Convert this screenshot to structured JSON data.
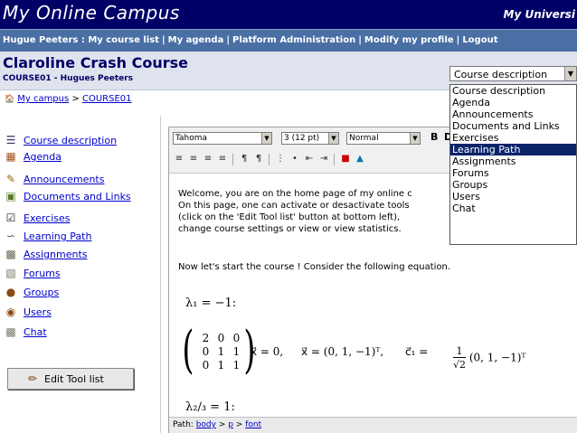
{
  "banner": {
    "title": "My Online Campus",
    "university": "My Universi"
  },
  "nav": {
    "user_label": "Hugue Peeters : My course list",
    "links": [
      "My agenda",
      "Platform Administration",
      "Modify my profile",
      "Logout"
    ]
  },
  "course": {
    "title": "Claroline Crash Course",
    "subtitle": "COURSE01 - Hugues Peeters"
  },
  "breadcrumb": {
    "home": "My campus",
    "current": "COURSE01"
  },
  "course_select": {
    "value": "Course description",
    "options": [
      "Course description",
      "Agenda",
      "Announcements",
      "Documents and Links",
      "Exercises",
      "Learning Path",
      "Assignments",
      "Forums",
      "Groups",
      "Users",
      "Chat"
    ],
    "highlighted": "Learning Path"
  },
  "tools": [
    {
      "label": "Course description",
      "icon": "list-icon"
    },
    {
      "label": "Agenda",
      "icon": "calendar-icon"
    },
    {
      "label": "Announcements",
      "icon": "announcement-icon"
    },
    {
      "label": "Documents and Links",
      "icon": "documents-icon"
    },
    {
      "label": "Exercises",
      "icon": "checkbox-icon"
    },
    {
      "label": "Learning Path",
      "icon": "path-icon"
    },
    {
      "label": "Assignments",
      "icon": "assignment-icon"
    },
    {
      "label": "Forums",
      "icon": "forum-icon"
    },
    {
      "label": "Groups",
      "icon": "groups-icon"
    },
    {
      "label": "Users",
      "icon": "user-icon"
    },
    {
      "label": "Chat",
      "icon": "chat-icon"
    }
  ],
  "edit_tools_label": "Edit Tool list",
  "editor": {
    "font": "Tahoma",
    "size": "3 (12 pt)",
    "format": "Normal",
    "bold": "B",
    "d": "D",
    "welcome_lines": [
      "Welcome, you are on the home page of my online c",
      "On this page, one can activate or desactivate tools",
      "(click on the 'Edit Tool list' button at bottom left),",
      "change course settings or view or view statistics."
    ],
    "start_text": "Now let's start the course ! Consider the following equation.",
    "math": {
      "lambda1": "λ₁ = −1:",
      "matrix_rows": [
        [
          "2",
          "0",
          "0"
        ],
        [
          "0",
          "1",
          "1"
        ],
        [
          "0",
          "1",
          "1"
        ]
      ],
      "eq1": "x⃗ = 0,",
      "eq2": "x⃗ = (0, 1, −1)ᵀ,",
      "eq3_lhs": "c⃗₁ =",
      "frac_num": "1",
      "frac_den": "√2",
      "eq3_rhs": "(0, 1, −1)ᵀ",
      "lambda23": "λ₂/₃ = 1:"
    },
    "path": {
      "label": "Path:",
      "items": [
        "body",
        "p",
        "font"
      ]
    }
  }
}
